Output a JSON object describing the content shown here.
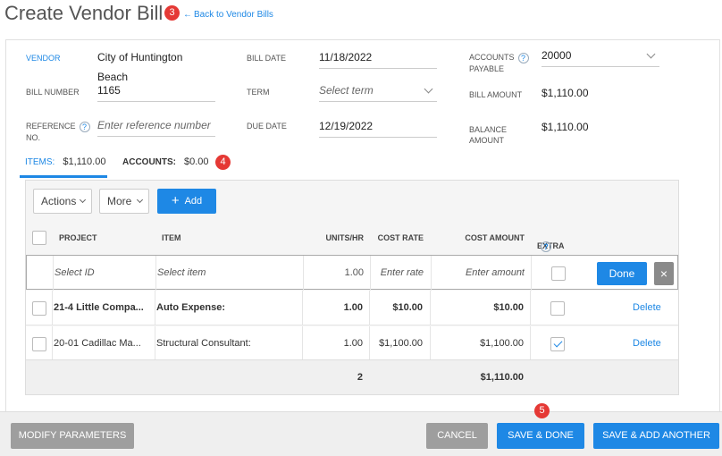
{
  "page": {
    "title": "Create Vendor Bill",
    "back_link": "Back to Vendor Bills",
    "badges": [
      "3",
      "4",
      "5"
    ]
  },
  "form": {
    "vendor_label": "VENDOR",
    "vendor_value": "City of Huntington Beach",
    "bill_number_label": "BILL NUMBER",
    "bill_number_value": "1165",
    "reference_label_1": "REFERENCE",
    "reference_label_2": "NO.",
    "reference_placeholder": "Enter reference number",
    "bill_date_label": "BILL DATE",
    "bill_date_value": "11/18/2022",
    "term_label": "TERM",
    "term_placeholder": "Select term",
    "due_date_label": "DUE DATE",
    "due_date_value": "12/19/2022",
    "accounts_payable_label_1": "ACCOUNTS",
    "accounts_payable_label_2": "PAYABLE",
    "accounts_payable_value": "20000",
    "bill_amount_label": "BILL AMOUNT",
    "bill_amount_value": "$1,110.00",
    "balance_amount_label_1": "BALANCE",
    "balance_amount_label_2": "AMOUNT",
    "balance_amount_value": "$1,110.00",
    "help_glyph": "?"
  },
  "tabs": {
    "items_label": "ITEMS:",
    "items_value": "$1,110.00",
    "accounts_label": "ACCOUNTS:",
    "accounts_value": "$0.00"
  },
  "toolbar": {
    "actions": "Actions",
    "more": "More",
    "add": "Add"
  },
  "table": {
    "columns": [
      "PROJECT",
      "ITEM",
      "UNITS/HR",
      "COST RATE",
      "COST AMOUNT",
      "EXTRA"
    ],
    "edit_row": {
      "project_ph": "Select ID",
      "item_ph": "Select item",
      "units": "1.00",
      "rate_ph": "Enter rate",
      "amount_ph": "Enter amount",
      "done": "Done",
      "close": "×"
    },
    "rows": [
      {
        "project": "21-4 Little Compa...",
        "item": "Auto Expense:",
        "units": "1.00",
        "rate": "$10.00",
        "amount": "$10.00",
        "extra": false,
        "action": "Delete"
      },
      {
        "project": "20-01 Cadillac Ma...",
        "item": "Structural Consultant:",
        "units": "1.00",
        "rate": "$1,100.00",
        "amount": "$1,100.00",
        "extra": true,
        "action": "Delete"
      }
    ],
    "totals": {
      "units": "2",
      "amount": "$1,110.00"
    }
  },
  "footer": {
    "modify": "MODIFY PARAMETERS",
    "cancel": "CANCEL",
    "save_done": "SAVE & DONE",
    "save_add": "SAVE & ADD ANOTHER"
  },
  "colors": {
    "accent": "#1e88e5",
    "badge": "#e53935",
    "neutral_button": "#9e9e9e"
  }
}
